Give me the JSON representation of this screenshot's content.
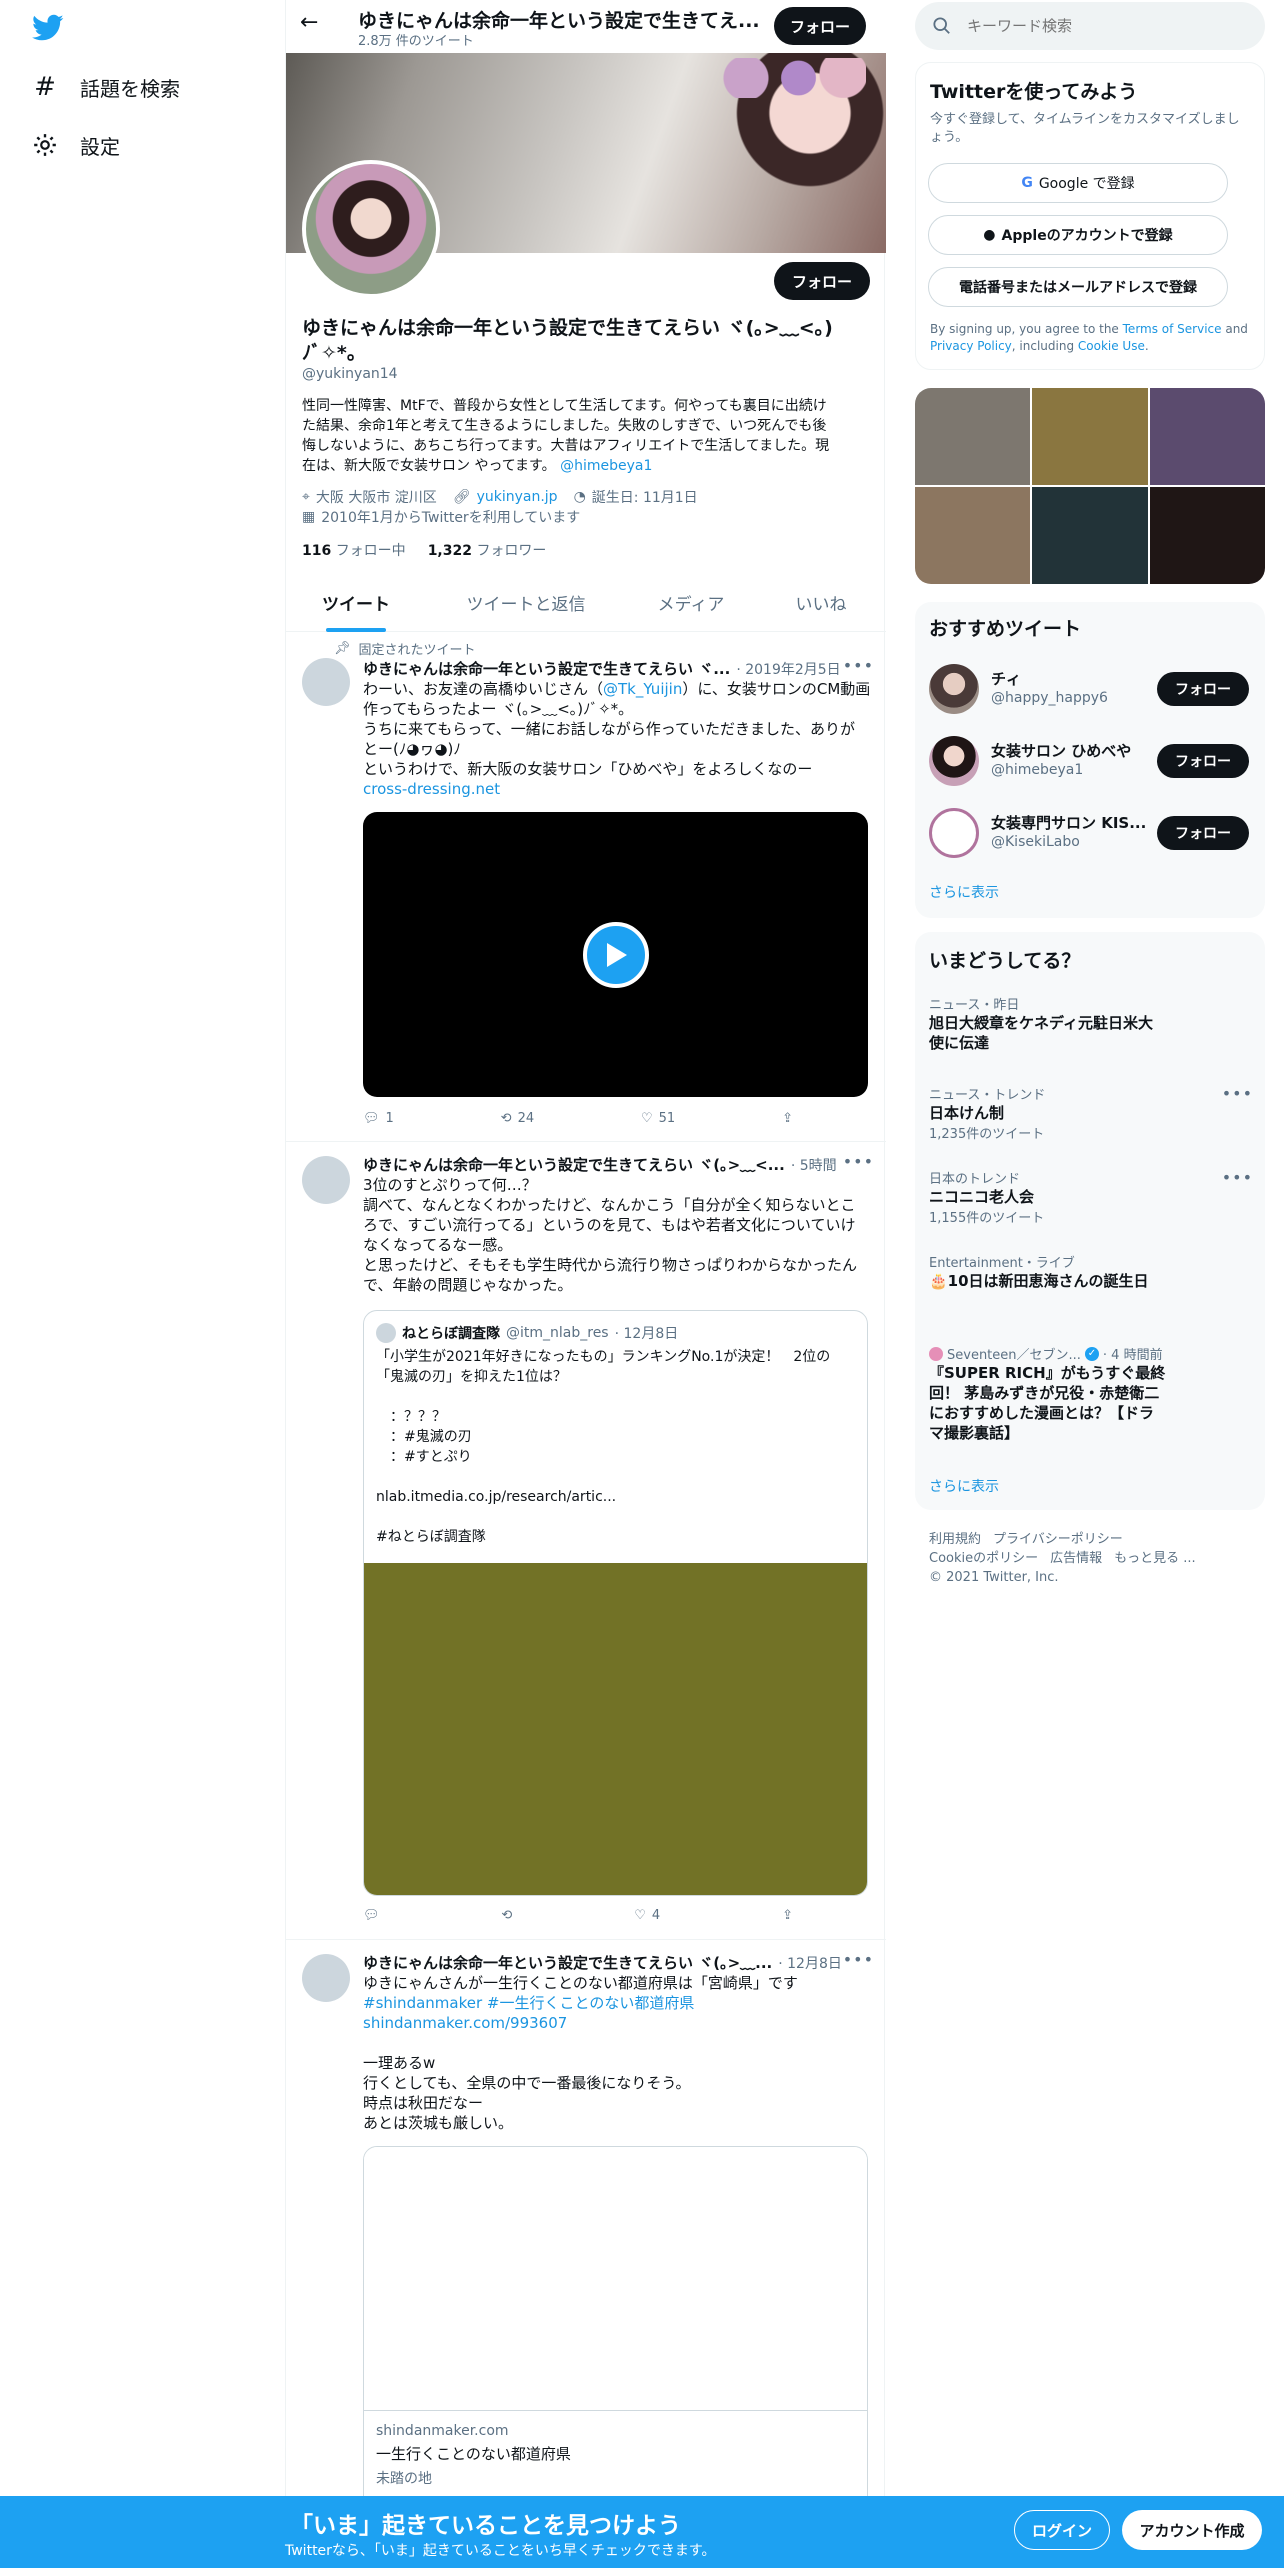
{
  "colors": {
    "brand": "#1da1f2",
    "link": "#1b95e0",
    "text": "#0f1419",
    "secondary": "#5b7083",
    "banner": "#1da1f2"
  },
  "nav": {
    "logo_icon": "twitter-bird-icon",
    "items": [
      {
        "label": "話題を検索",
        "icon": "hashtag-icon"
      },
      {
        "label": "設定",
        "icon": "gear-icon"
      }
    ]
  },
  "header": {
    "name": "ゆきにゃんは余命一年という設定で生きてえ...",
    "tweet_count": "2.8万 件のツイート",
    "follow": "フォロー"
  },
  "profile": {
    "follow": "フォロー",
    "name_line1": "ゆきにゃんは余命一年という設定で生きてえらい ヾ(｡>﹏<｡)",
    "name_line2": "ﾉﾞ✧*。",
    "handle": "@yukinyan14",
    "bio_lines": [
      "性同一性障害、MtFで、普段から女性として生活してます。何やっても裏目に出続け",
      "た結果、余命1年と考えて生きるようにしました。失敗のしすぎで、いつ死んでも後",
      "悔しないように、あちこち行ってます。大昔はアフィリエイトで生活してました。現"
    ],
    "bio_last": "在は、新大阪で女装サロン やってます。",
    "bio_mention": "@himebeya1",
    "location": "大阪 大阪市 淀川区",
    "website": "yukinyan.jp",
    "birthday": "誕生日: 11月1日",
    "joined": "2010年1月からTwitterを利用しています",
    "following_count": "116",
    "following_label": "フォロー中",
    "followers_count": "1,322",
    "followers_label": "フォロワー"
  },
  "tabs": [
    "ツイート",
    "ツイートと返信",
    "メディア",
    "いいね"
  ],
  "tweets": {
    "pinned_label": "固定されたツイート",
    "t1": {
      "name": "ゆきにゃんは余命一年という設定で生きてえらい ヾ...",
      "time": "· 2019年2月5日",
      "line1_a": "わーい、お友達の高橋ゆいじさん（",
      "line1_mention": "@Tk_Yuijin",
      "line1_b": "）に、女装サロンのCM動画",
      "line2": "作ってもらったよー ヾ(｡>﹏<｡)ﾉﾞ✧*。",
      "line3": "うちに来てもらって、一緒にお話しながら作っていただきました、ありが",
      "line4": "とー(ﾉ◕ヮ◕)ﾉ",
      "line5": "というわけで、新大阪の女装サロン「ひめべや」をよろしくなのー",
      "link": "cross-dressing.net",
      "replies": "1",
      "retweets": "24",
      "likes": "51"
    },
    "t2": {
      "name": "ゆきにゃんは余命一年という設定で生きてえらい ヾ(｡>﹏<...",
      "time": "· 5時間",
      "lines": [
        "3位のすとぷりって何…？",
        "調べて、なんとなくわかったけど、なんかこう「自分が全く知らないとこ",
        "ろで、すごい流行ってる」というのを見て、もはや若者文化についていけ",
        "なくなってるなー感。",
        "と思ったけど、そもそも学生時代から流行り物さっぱりわからなかったん",
        "で、年齢の問題じゃなかった。"
      ],
      "quote": {
        "name": "ねとらぼ調査隊",
        "handle": "@itm_nlab_res",
        "time": "· 12月8日",
        "lines": [
          "「小学生が2021年好きになったもの」ランキングNo.1が決定！　2位の",
          "「鬼滅の刃」を抑えた1位は？",
          "",
          "　：？？？",
          "　：#鬼滅の刃",
          "　：#すとぷり",
          "",
          "nlab.itmedia.co.jp/research/artic...",
          "",
          "#ねとらぼ調査隊"
        ]
      },
      "replies": "",
      "retweets": "",
      "likes": "4"
    },
    "t3": {
      "name": "ゆきにゃんは余命一年という設定で生きてえらい ヾ(｡>﹏...",
      "time": "· 12月8日",
      "line1": "ゆきにゃんさんが一生行くことのない都道府県は「宮崎県」です",
      "hashtags": "#shindanmaker #一生行くことのない都道府県",
      "link": "shindanmaker.com/993607",
      "lines": [
        "一理あるw",
        "行くとしても、全県の中で一番最後になりそう。",
        "時点は秋田だなー",
        "あとは茨城も厳しい。"
      ],
      "card": {
        "domain": "shindanmaker.com",
        "title": "一生行くことのない都道府県",
        "desc": "未踏の地"
      }
    }
  },
  "search": {
    "placeholder": "キーワード検索"
  },
  "signup": {
    "title": "Twitterを使ってみよう",
    "subtitle": "今すぐ登録して、タイムラインをカスタマイズしましょう。",
    "google": "Google で登録",
    "apple": "Appleのアカウントで登録",
    "phone": "電話番号またはメールアドレスで登録",
    "terms_a": "By signing up, you agree to the ",
    "terms_tos": "Terms of Service",
    "terms_and": " and",
    "terms_pp": "Privacy Policy",
    "terms_inc": ", including ",
    "terms_cookie": "Cookie Use",
    "terms_end": "."
  },
  "media_grid": [
    "#7d776f",
    "#8a7640",
    "#5b4b6e",
    "#8c7660",
    "#223338",
    "#1f1615"
  ],
  "recommended": {
    "title": "おすすめツイート",
    "users": [
      {
        "name": "チィ",
        "handle": "@happy_happy6"
      },
      {
        "name": "女装サロン ひめべや",
        "handle": "@himebeya1"
      },
      {
        "name": "女装専門サロン KIS...",
        "handle": "@KisekiLabo"
      }
    ],
    "follow": "フォロー",
    "more": "さらに表示"
  },
  "trends": {
    "title": "いまどうしてる？",
    "items": [
      {
        "cat": "ニュース・昨日",
        "name1": "旭日大綬章をケネディ元駐日米大",
        "name2": "使に伝達",
        "count": ""
      },
      {
        "cat": "ニュース・トレンド",
        "name1": "日本けん制",
        "name2": "",
        "count": "1,235件のツイート"
      },
      {
        "cat": "日本のトレンド",
        "name1": "ニコニコ老人会",
        "name2": "",
        "count": "1,155件のツイート"
      },
      {
        "cat": "Entertainment・ライブ",
        "name1": "🎂10日は新田恵海さんの誕生日",
        "name2": "",
        "count": ""
      }
    ],
    "news": {
      "source": "Seventeen／セブン...",
      "time": "· 4 時間前",
      "lines": [
        "『SUPER RICH』がもうすぐ最終",
        "回！ 茅島みずきが兄役・赤楚衛二",
        "におすすめした漫画とは？【ドラ",
        "マ撮影裏話】"
      ]
    },
    "more": "さらに表示"
  },
  "footer": {
    "line1": [
      "利用規約",
      "プライバシーポリシー"
    ],
    "line2": [
      "Cookieのポリシー",
      "広告情報",
      "もっと見る ..."
    ],
    "copyright": "© 2021 Twitter, Inc."
  },
  "banner": {
    "title": "「いま」起きていることを見つけよう",
    "sub": "Twitterなら、「いま」起きていることをいち早くチェックできます。",
    "login": "ログイン",
    "signup": "アカウント作成"
  }
}
